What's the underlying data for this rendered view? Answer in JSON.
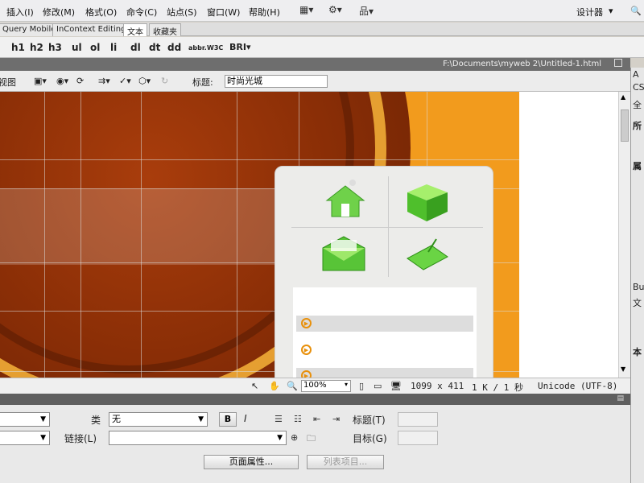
{
  "menu": {
    "items": [
      "插入(I)",
      "修改(M)",
      "格式(O)",
      "命令(C)",
      "站点(S)",
      "窗口(W)",
      "帮助(H)"
    ],
    "workspace": "设计器"
  },
  "insert_tabs": [
    "Query Mobile",
    "InContext Editing",
    "文本",
    "收藏夹"
  ],
  "insert_toolbar": [
    "h1",
    "h2",
    "h3",
    "ul",
    "ol",
    "li",
    "dl",
    "dt",
    "dd",
    "abbr.",
    "W3C"
  ],
  "path_bar": {
    "path": "F:\\Documents\\myweb 2\\Untitled-1.html"
  },
  "doc_toolbar": {
    "view_label": "视图",
    "title_label": "标题:",
    "title_value": "时尚光城"
  },
  "status_bar": {
    "zoom": "100%",
    "dimensions": "1099 x 411",
    "size": "1 K / 1 秒",
    "encoding": "Unicode (UTF-8)"
  },
  "right_panel": [
    "A",
    "CS",
    "全",
    "所",
    "属",
    "Bu",
    "文",
    "本"
  ],
  "properties": {
    "class_label": "类",
    "class_value": "无",
    "link_label": "链接(L)",
    "title_label": "标题(T)",
    "target_label": "目标(G)",
    "page_props_button": "页面属性...",
    "list_item_button": "列表项目...",
    "bold": "B",
    "italic": "I"
  }
}
